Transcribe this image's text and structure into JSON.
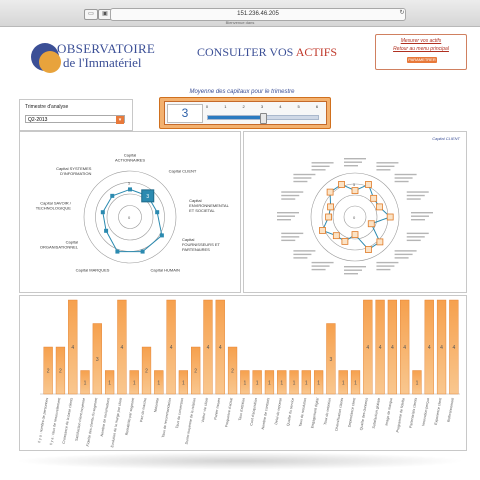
{
  "browser": {
    "url": "151.236.46.205",
    "tab_title": "Bienvenue dans"
  },
  "logo": {
    "line1": "OBSERVATOIRE",
    "line2": "de l'Immatériel"
  },
  "header": {
    "title_main": "CONSULTER VOS ",
    "title_accent": "ACTIFS"
  },
  "menu": {
    "link1": "Mesurer vos actifs",
    "link2": "Retour au menu principal",
    "button": "PARAMETRER"
  },
  "period": {
    "label": "Trimestre d'analyse",
    "selected": "Q2-2013"
  },
  "average": {
    "title": "Moyenne des capitaux pour le trimestre",
    "value": "3",
    "scale": [
      "0",
      "1",
      "2",
      "3",
      "4",
      "5",
      "6"
    ],
    "level": 0.5
  },
  "radar1": {
    "labels": [
      "Capital ACTIONNAIRES",
      "Capital CLIENT",
      "Capital ENVIRONNEMENTAL ET SOCIETAL",
      "Capital FOURNISSEURS ET PARTENAIRES",
      "Capital HUMAIN",
      "Capital MARQUES",
      "Capital ORGANISATIONNEL",
      "Capital SAVOIR / TECHNOLOGIQUE",
      "Capital SYSTEMES D'INFORMATION"
    ],
    "values": [
      3,
      3,
      3,
      4,
      4,
      4,
      3,
      3,
      3
    ],
    "scale_labels": [
      "0",
      "5"
    ],
    "selected_index": 1
  },
  "radar2": {
    "title": "Capital CLIENT",
    "values": [
      3,
      4,
      3,
      3,
      4,
      2,
      4,
      4,
      2,
      3,
      3,
      4,
      3,
      3,
      4,
      4
    ],
    "scale_labels": [
      "0",
      "5"
    ]
  },
  "bars": {
    "values": [
      2,
      2,
      4,
      1,
      3,
      1,
      4,
      1,
      2,
      1,
      4,
      1,
      2,
      4,
      4,
      2,
      1,
      1,
      1,
      1,
      1,
      1,
      1,
      3,
      1,
      1,
      4,
      4,
      4,
      4,
      1,
      4,
      4,
      4
    ],
    "labels": [
      "Il y a : nombre de personnes",
      "Il y a : taux de renouvellement",
      "Croissance de la base clients",
      "Satisfaction client moyenne",
      "Fidelite des clients du segment",
      "Nombre de reclamations",
      "Evolution de la marge par client",
      "Rentabilite par segment",
      "Part de marche",
      "Notoriete",
      "Taux de recommandation",
      "Taux de conversion",
      "Duree moyenne de la relation",
      "Valeur vie client",
      "Panier moyen",
      "Frequence d'achat",
      "Taux d'attrition",
      "Cout d'acquisition",
      "Nombre de contacts",
      "Delai de reponse",
      "Qualite du service",
      "Taux de resolution",
      "Engagement digital",
      "Taux de retention",
      "Diversification clients",
      "Dependance client",
      "Qualite des donnees",
      "Satisfaction globale",
      "Image de marque",
      "Programme de fidelite",
      "Partenariats clients",
      "Innovation perçue",
      "Experience client",
      "Referencement"
    ]
  }
}
